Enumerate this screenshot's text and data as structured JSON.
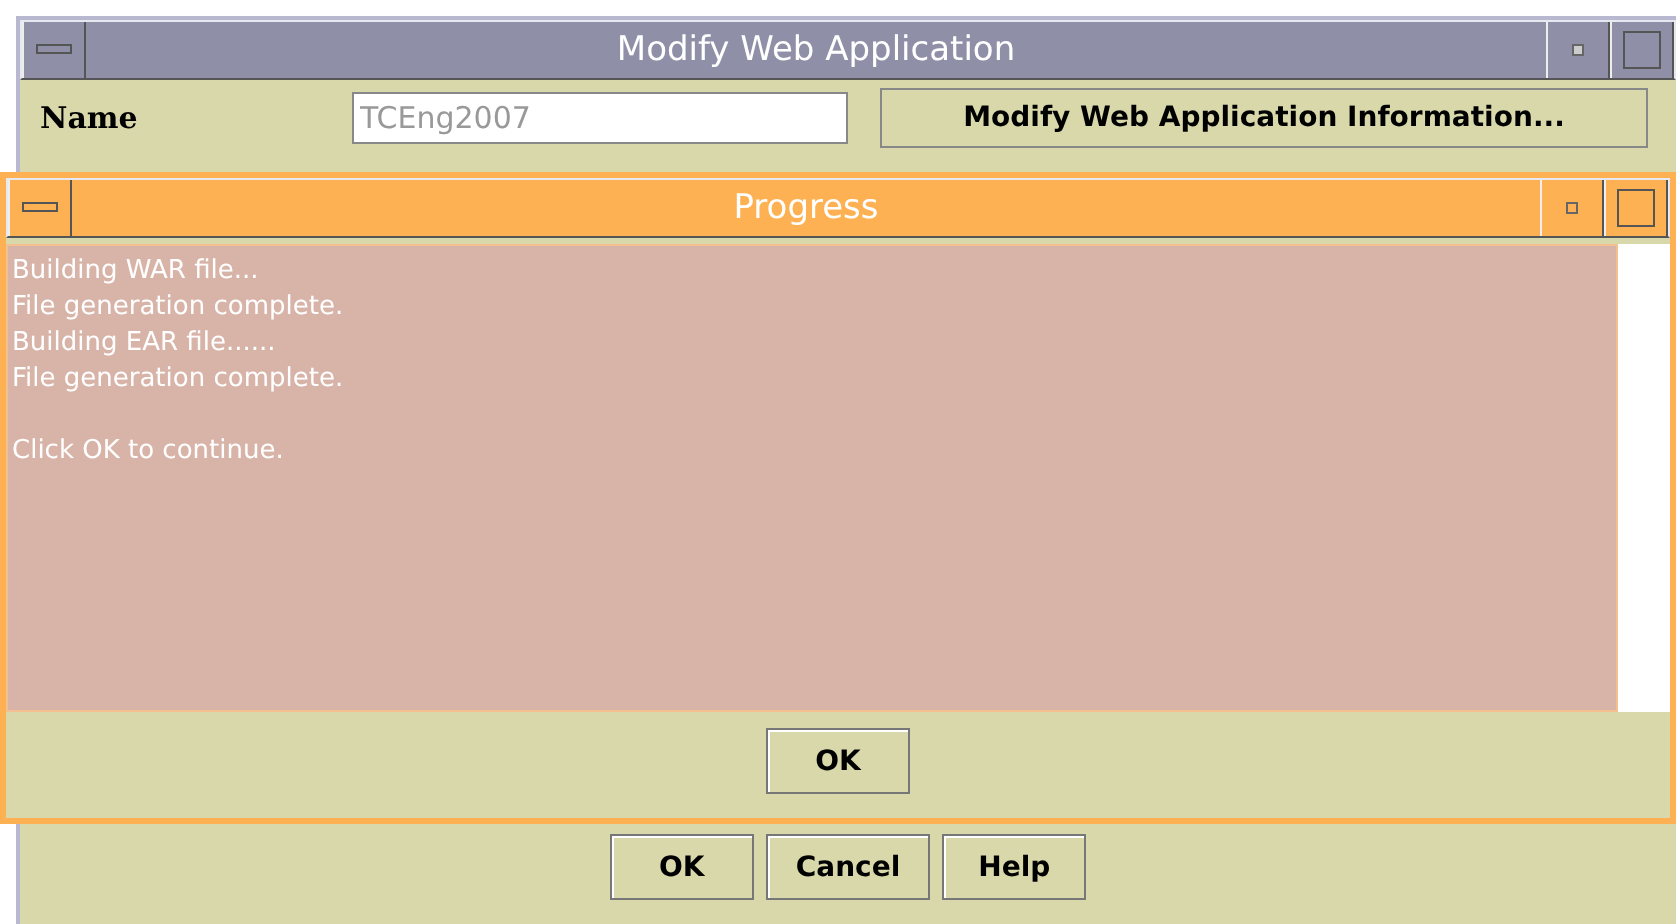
{
  "main_window": {
    "title": "Modify Web Application",
    "name_label": "Name",
    "name_value": "TCEng2007",
    "info_button": "Modify Web Application Information...",
    "buttons": [
      "OK",
      "Cancel",
      "Help"
    ]
  },
  "progress_dialog": {
    "title": "Progress",
    "lines": [
      "Building WAR file...",
      "File generation complete.",
      "Building EAR file......",
      "File generation complete."
    ],
    "footer": "Click OK to continue.",
    "button": "OK"
  }
}
